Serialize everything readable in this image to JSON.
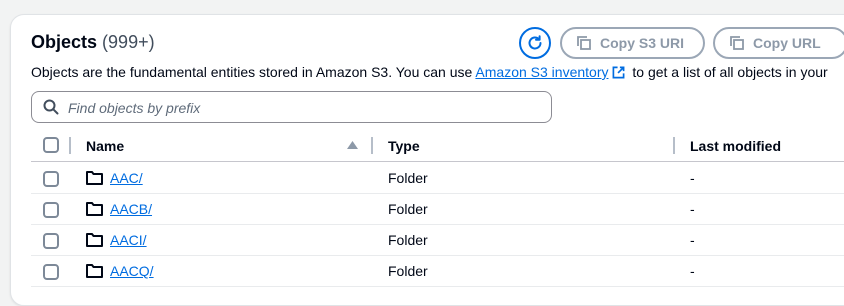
{
  "header": {
    "title": "Objects",
    "count": "(999+)",
    "copy_s3_uri_label": "Copy S3 URI",
    "copy_url_label": "Copy URL"
  },
  "description": {
    "text_before": "Objects are the fundamental entities stored in Amazon S3. You can use ",
    "link_text": "Amazon S3 inventory",
    "text_after": " to get a list of all objects in your"
  },
  "search": {
    "placeholder": "Find objects by prefix",
    "value": ""
  },
  "table": {
    "columns": {
      "name": "Name",
      "type": "Type",
      "last_modified": "Last modified"
    },
    "rows": [
      {
        "name": "AAC/",
        "type": "Folder",
        "last_modified": "-"
      },
      {
        "name": "AACB/",
        "type": "Folder",
        "last_modified": "-"
      },
      {
        "name": "AACI/",
        "type": "Folder",
        "last_modified": "-"
      },
      {
        "name": "AACQ/",
        "type": "Folder",
        "last_modified": "-"
      }
    ]
  },
  "colors": {
    "link": "#006ce0",
    "text": "#000716",
    "disabled": "#8d99a8"
  }
}
